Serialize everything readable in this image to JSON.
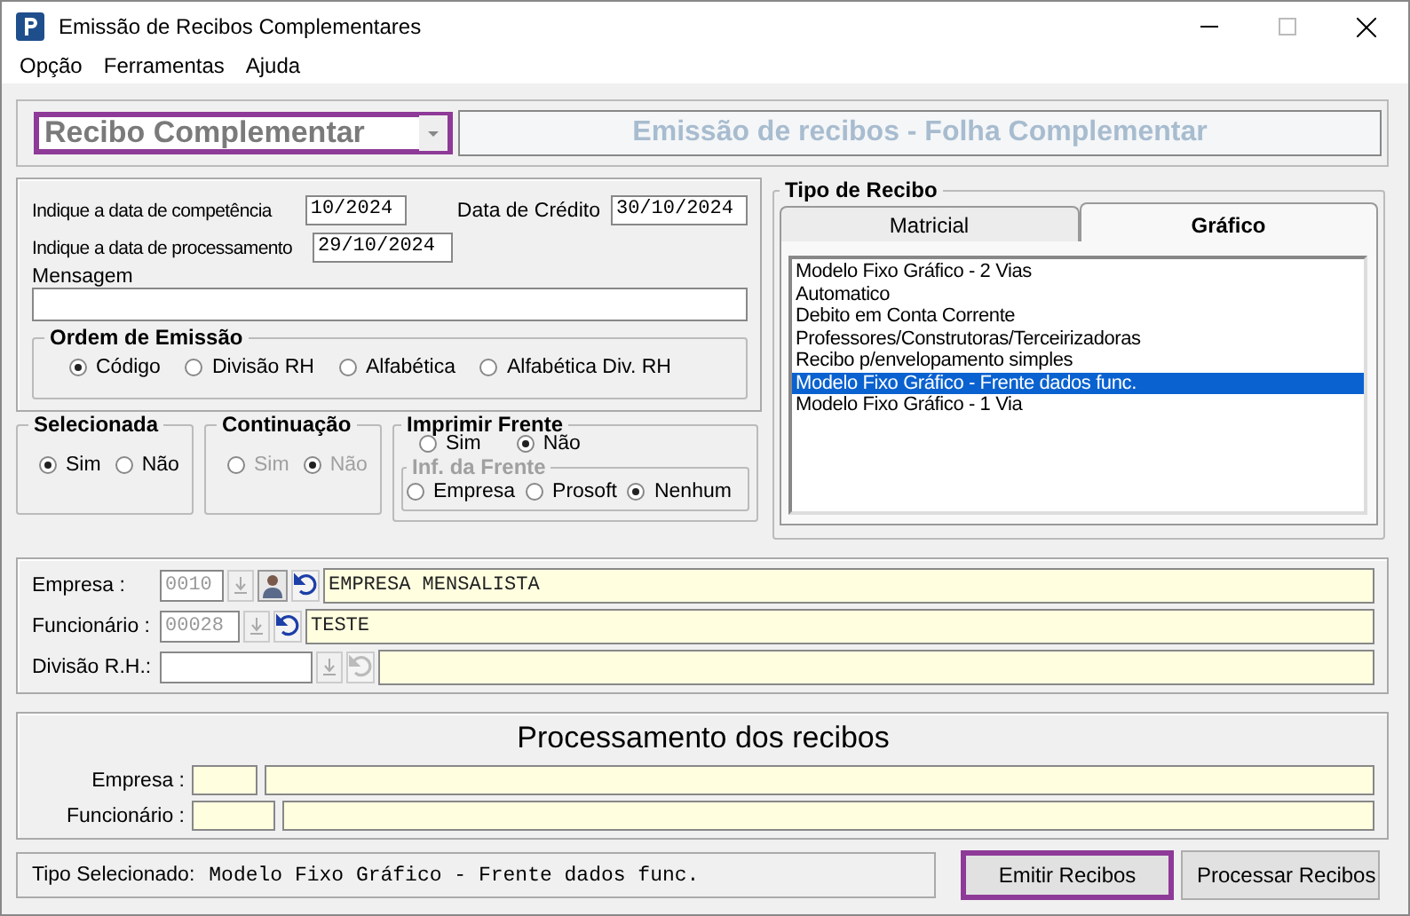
{
  "window": {
    "title": "Emissão de Recibos Complementares"
  },
  "menu": [
    "Opção",
    "Ferramentas",
    "Ajuda"
  ],
  "receipt_combo": {
    "value": "Recibo Complementar",
    "focused": true
  },
  "banner": "Emissão de recibos - Folha Complementar",
  "competencia": {
    "label": "Indique a data de competência",
    "value": "10/2024"
  },
  "credito": {
    "label": "Data de Crédito",
    "value": "30/10/2024"
  },
  "processamento_data": {
    "label": "Indique a data de processamento",
    "value": "29/10/2024"
  },
  "mensagem": {
    "label": "Mensagem"
  },
  "ordem": {
    "title": "Ordem de Emissão",
    "options": [
      {
        "label": "Código",
        "selected": true
      },
      {
        "label": "Divisão RH",
        "selected": false
      },
      {
        "label": "Alfabética",
        "selected": false
      },
      {
        "label": "Alfabética Div.  RH",
        "selected": false
      }
    ]
  },
  "selecionada": {
    "title": "Selecionada",
    "disabled": false,
    "options": [
      {
        "label": "Sim",
        "selected": true
      },
      {
        "label": "Não",
        "selected": false
      }
    ]
  },
  "continuacao": {
    "title": "Continuação",
    "disabled": true,
    "options": [
      {
        "label": "Sim",
        "selected": false
      },
      {
        "label": "Não",
        "selected": true
      }
    ]
  },
  "imprimir_frente": {
    "title": "Imprimir Frente",
    "options": [
      {
        "label": "Sim",
        "selected": false
      },
      {
        "label": "Não",
        "selected": true
      }
    ],
    "inf": {
      "title": "Inf. da Frente",
      "options": [
        {
          "label": "Empresa",
          "selected": false
        },
        {
          "label": "Prosoft",
          "selected": false
        },
        {
          "label": "Nenhum",
          "selected": true
        }
      ]
    }
  },
  "tipo_recibo": {
    "title": "Tipo de Recibo",
    "tabs": [
      {
        "label": "Matricial",
        "selected": false
      },
      {
        "label": "Gráfico",
        "selected": true
      }
    ],
    "items": [
      {
        "label": "Modelo Fixo Gráfico - 2 Vias",
        "selected": false
      },
      {
        "label": "Automatico",
        "selected": false
      },
      {
        "label": "Debito em Conta Corrente",
        "selected": false
      },
      {
        "label": "Professores/Construtoras/Terceirizadoras",
        "selected": false
      },
      {
        "label": "Recibo p/envelopamento simples",
        "selected": false
      },
      {
        "label": "Modelo Fixo Gráfico - Frente dados func.",
        "selected": true
      },
      {
        "label": "Modelo Fixo Gráfico - 1 Via",
        "selected": false
      }
    ]
  },
  "lookups": [
    {
      "label": "Empresa :",
      "code": "0010",
      "name": "EMPRESA MENSALISTA",
      "enabled": true,
      "person_button": true
    },
    {
      "label": "Funcionário :",
      "code": "00028",
      "name": "TESTE",
      "enabled": true,
      "person_button": false
    },
    {
      "label": "Divisão R.H.:",
      "enabled": false,
      "person_button": false
    }
  ],
  "processamento": {
    "title": "Processamento dos recibos",
    "rows": [
      {
        "label": "Empresa :"
      },
      {
        "label": "Funcionário :"
      }
    ]
  },
  "status": {
    "label": "Tipo Selecionado:",
    "value": "Modelo Fixo Gráfico - Frente dados func."
  },
  "buttons": [
    {
      "label": "Emitir Recibos",
      "focused": true
    },
    {
      "label": "Processar Recibos",
      "focused": false
    }
  ]
}
